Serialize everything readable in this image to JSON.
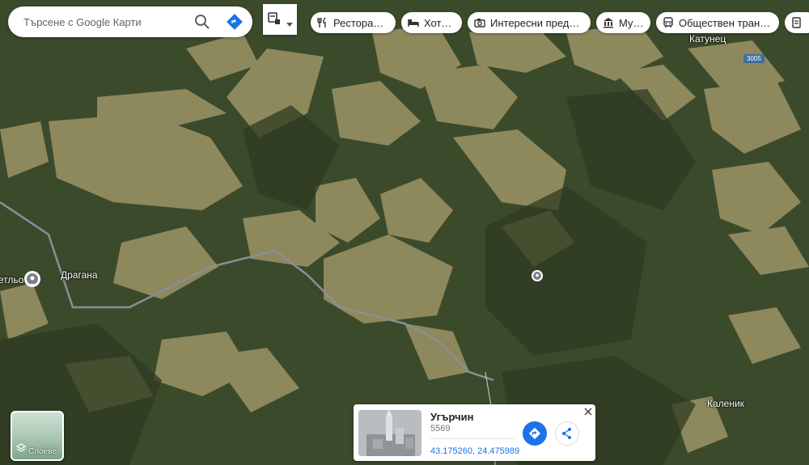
{
  "search": {
    "placeholder": "Търсене с Google Карти"
  },
  "icons": {
    "search": "search-icon",
    "directions": "directions-icon",
    "transit_layer": "transit-layer-icon",
    "dropdown": "chevron-down-icon",
    "restaurant": "fork-knife-icon",
    "hotel": "bed-icon",
    "attractions": "camera-icon",
    "museum": "museum-icon",
    "transit": "bus-icon",
    "pin": "place-pin-icon",
    "layers": "layers-icon",
    "close": "close-icon",
    "share": "share-icon"
  },
  "categories": [
    {
      "label": "Ресторанти"
    },
    {
      "label": "Хотели"
    },
    {
      "label": "Интересни предло…"
    },
    {
      "label": "Музеи"
    },
    {
      "label": "Обществен транс…"
    },
    {
      "label": ""
    }
  ],
  "map": {
    "labels": {
      "katunets": "Катунец",
      "dragana": "Драгана",
      "svetlo": "етльо",
      "kalenik": "Каленик"
    },
    "road_shield": "3005"
  },
  "layers": {
    "label": "Слоеве"
  },
  "info_card": {
    "title": "Угърчин",
    "postal_code": "5569",
    "coordinates": "43.175260, 24.475989"
  },
  "colors": {
    "accent": "#1a73e8",
    "road_shield": "#3d6fa0"
  }
}
